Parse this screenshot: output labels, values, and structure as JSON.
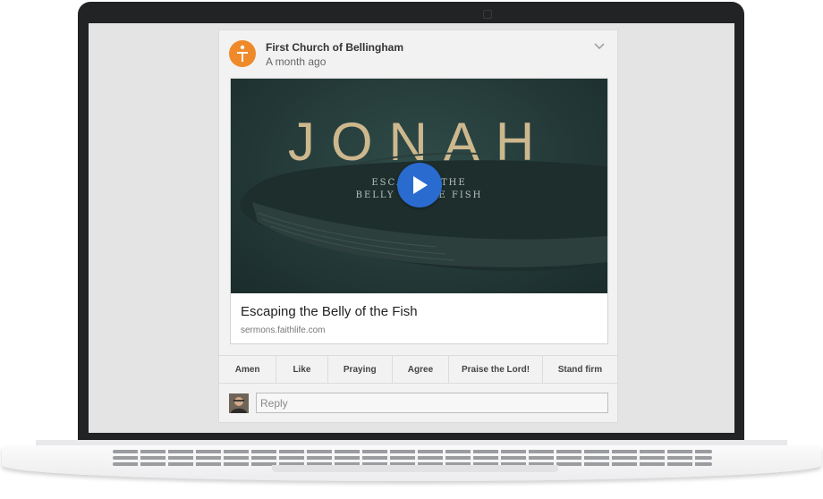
{
  "post": {
    "org_name": "First Church of Bellingham",
    "time": "A month ago",
    "video": {
      "title_art": "JONAH",
      "subtitle_line1": "ESCAPING THE",
      "subtitle_line2": "BELLY OF THE FISH"
    },
    "link_title": "Escaping the Belly of the Fish",
    "link_url": "sermons.faithlife.com"
  },
  "reactions": [
    "Amen",
    "Like",
    "Praying",
    "Agree",
    "Praise the Lord!",
    "Stand firm"
  ],
  "reply": {
    "placeholder": "Reply",
    "value": ""
  },
  "colors": {
    "org_avatar": "#ef8a2a",
    "play_button": "#2a6bd0"
  }
}
